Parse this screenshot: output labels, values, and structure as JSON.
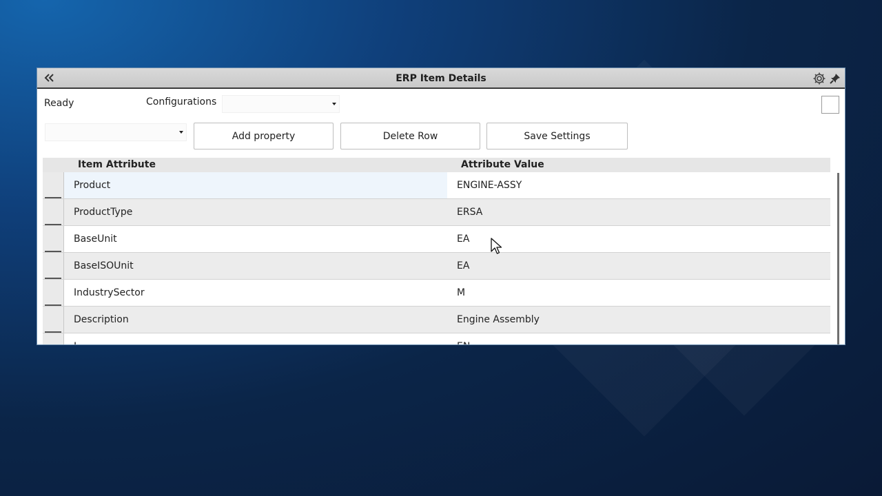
{
  "window": {
    "title": "ERP Item Details",
    "icons": [
      "double-chevron-left-icon",
      "gear-icon",
      "pin-icon"
    ]
  },
  "toolbar": {
    "status": "Ready",
    "configurations_label": "Configurations",
    "configurations_value": "",
    "secondary_select_value": "",
    "add_property_label": "Add property",
    "delete_row_label": "Delete Row",
    "save_settings_label": "Save Settings"
  },
  "grid": {
    "columns": [
      "Item Attribute",
      "Attribute Value"
    ],
    "rows": [
      {
        "attribute": "Product",
        "value": "ENGINE-ASSY"
      },
      {
        "attribute": "ProductType",
        "value": "ERSA"
      },
      {
        "attribute": "BaseUnit",
        "value": "EA"
      },
      {
        "attribute": "BaseISOUnit",
        "value": "EA"
      },
      {
        "attribute": "IndustrySector",
        "value": "M"
      },
      {
        "attribute": "Description",
        "value": "Engine Assembly"
      },
      {
        "attribute": "L",
        "value": "EN"
      }
    ]
  },
  "colors": {
    "titlebar": "#d0d0d0",
    "background": "#0b2548",
    "selected_cell": "#eef5fc"
  }
}
